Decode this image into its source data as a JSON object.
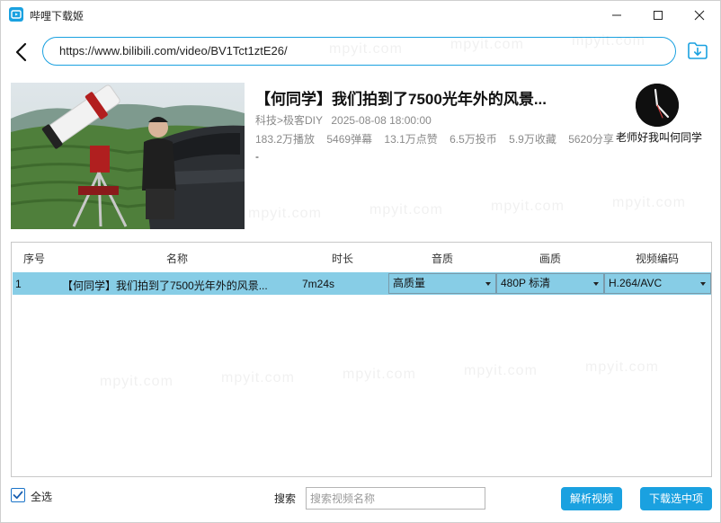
{
  "window": {
    "title": "哔哩下载姬"
  },
  "url_bar": {
    "value": "https://www.bilibili.com/video/BV1Tct1ztE26/"
  },
  "video": {
    "title": "【何同学】我们拍到了7500光年外的风景...",
    "category": "科技>极客DIY",
    "publish_time": "2025-08-08 18:00:00",
    "stats": [
      "183.2万播放",
      "5469弹幕",
      "13.1万点赞",
      "6.5万投币",
      "5.9万收藏",
      "5620分享"
    ],
    "description": "-",
    "uploader": "老师好我叫何同学"
  },
  "table": {
    "headers": {
      "index": "序号",
      "name": "名称",
      "duration": "时长",
      "audio": "音质",
      "video_quality": "画质",
      "codec": "视频编码"
    },
    "rows": [
      {
        "index": "1",
        "name": "【何同学】我们拍到了7500光年外的风景...",
        "duration": "7m24s",
        "audio": "高质量",
        "video_quality": "480P 标清",
        "codec": "H.264/AVC"
      }
    ]
  },
  "bottom": {
    "select_all_label": "全选",
    "select_all_checked": true,
    "search_label": "搜索",
    "search_placeholder": "搜索视频名称",
    "parse_button": "解析视频",
    "download_button": "下载选中项"
  },
  "watermark": "mpyit.com",
  "colors": {
    "accent": "#1aa1e0",
    "selected_row": "#87cde6"
  }
}
